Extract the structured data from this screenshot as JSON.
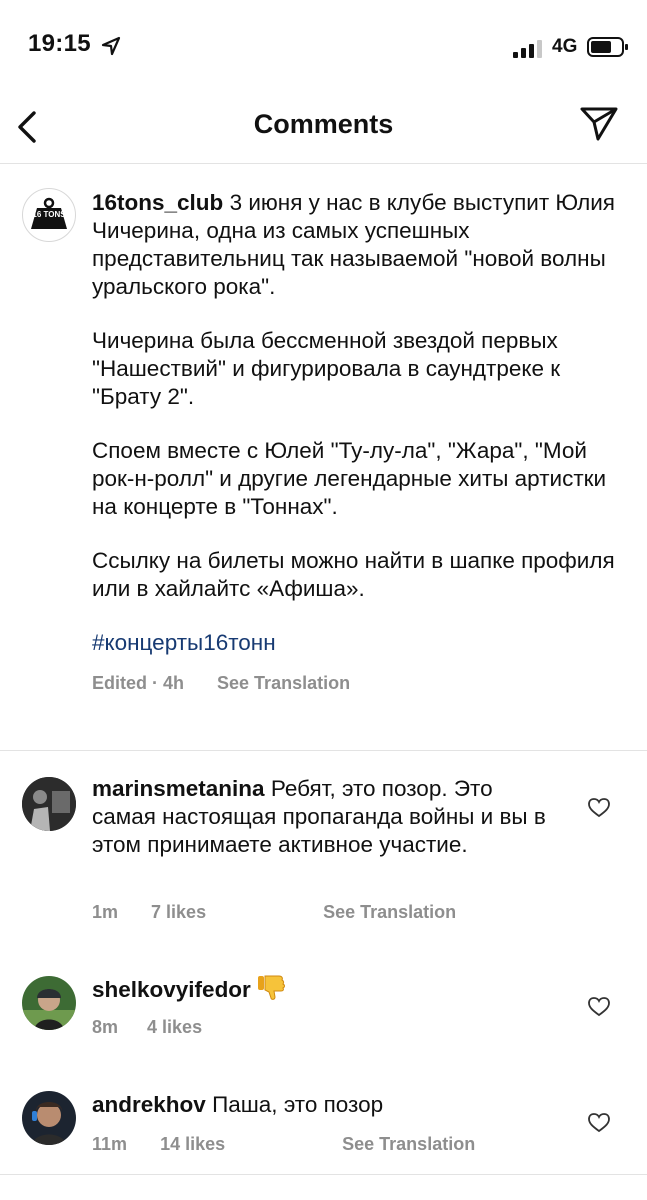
{
  "status_bar": {
    "time": "19:15",
    "network": "4G"
  },
  "header": {
    "title": "Comments"
  },
  "caption": {
    "username": "16tons_club",
    "paragraphs": [
      "3 июня у нас в клубе выступит Юлия Чичерина, одна из самых успешных представительниц так называемой \"новой волны уральского рока\".",
      "Чичерина была бессменной звездой первых \"Нашествий\" и фигурировала в саундтреке к \"Брату 2\".",
      "Споем вместе с Юлей \"Ту-лу-ла\", \"Жара\", \"Мой рок-н-ролл\" и другие легендарные хиты артистки на концерте в \"Тоннах\".",
      "Ссылку на билеты можно найти в шапке профиля или в хайлайтс «Афиша»."
    ],
    "hashtag": "#концерты16тонн",
    "edited": "Edited · 4h",
    "see_translation": "See Translation",
    "logo_text": "16 TONS"
  },
  "comments": [
    {
      "username": "marinsmetanina",
      "text": "Ребят, это позор. Это самая настоящая пропаганда войны и вы в этом принимаете активное участие.",
      "time": "1m",
      "likes": "7 likes",
      "see_translation": "See Translation"
    },
    {
      "username": "shelkovyifedor",
      "text": "",
      "emoji": "thumbs-down",
      "time": "8m",
      "likes": "4 likes"
    },
    {
      "username": "andrekhov",
      "text": "Паша, это позор",
      "time": "11m",
      "likes": "14 likes",
      "see_translation": "See Translation"
    }
  ],
  "colors": {
    "hashtag": "#173a72",
    "meta": "#8e8e8e",
    "divider": "#e3e3e3"
  }
}
